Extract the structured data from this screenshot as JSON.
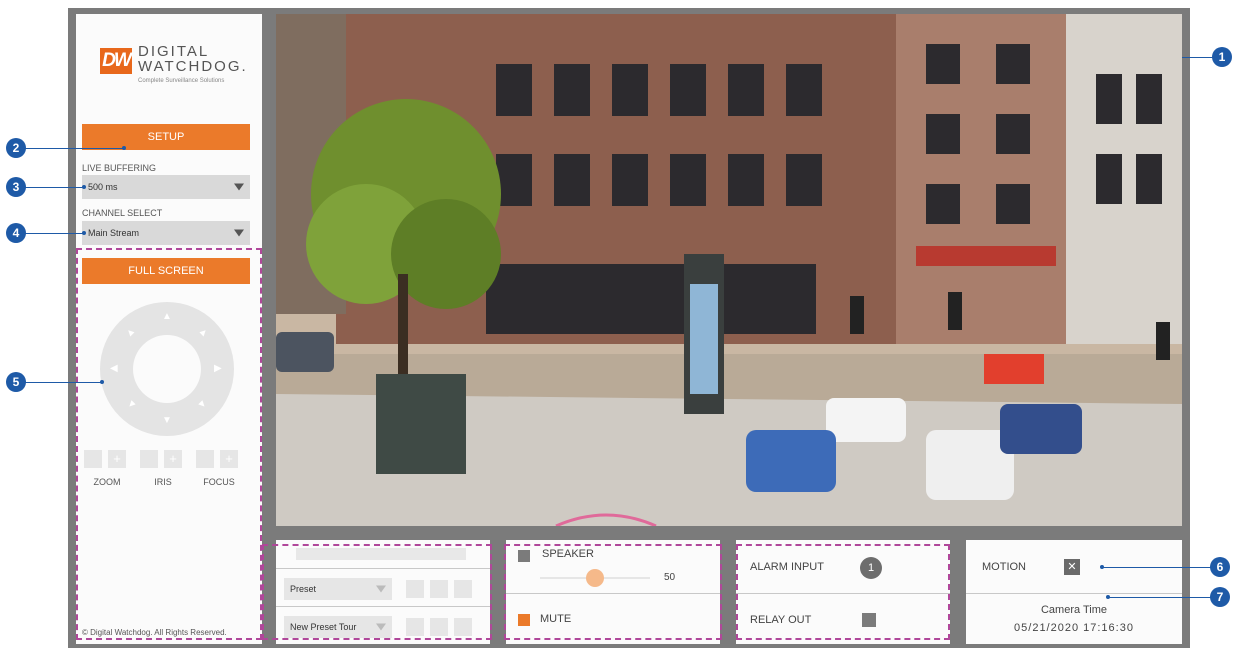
{
  "brand": {
    "logo_mark": "DW",
    "line1": "DIGITAL",
    "line2": "WATCHDOG.",
    "tagline": "Complete Surveillance Solutions"
  },
  "sidebar": {
    "setup_button": "SETUP",
    "live_buffering": {
      "label": "LIVE BUFFERING",
      "value": "500 ms"
    },
    "channel_select": {
      "label": "CHANNEL SELECT",
      "value": "Main Stream"
    },
    "full_screen_button": "FULL SCREEN",
    "controls": {
      "zoom": "ZOOM",
      "iris": "IRIS",
      "focus": "FOCUS"
    },
    "copyright": "© Digital Watchdog. All Rights Reserved."
  },
  "preset_panel": {
    "preset_select": "Preset",
    "preset_tour_select": "New Preset Tour"
  },
  "audio_panel": {
    "speaker_label": "SPEAKER",
    "volume_value": "50",
    "volume_fraction": 0.5,
    "mute_label": "MUTE"
  },
  "alarm_panel": {
    "alarm_input_label": "ALARM INPUT",
    "alarm_input_number": "1",
    "relay_out_label": "RELAY OUT"
  },
  "status_panel": {
    "motion_label": "MOTION",
    "camera_time_label": "Camera Time",
    "camera_time_value": "05/21/2020 17:16:30"
  },
  "callouts": [
    "1",
    "2",
    "3",
    "4",
    "5",
    "6",
    "7"
  ],
  "colors": {
    "accent": "#eb7a2a",
    "callout": "#1e5aa7",
    "frame": "#7b7b7b",
    "dashed": "#b0479a"
  }
}
